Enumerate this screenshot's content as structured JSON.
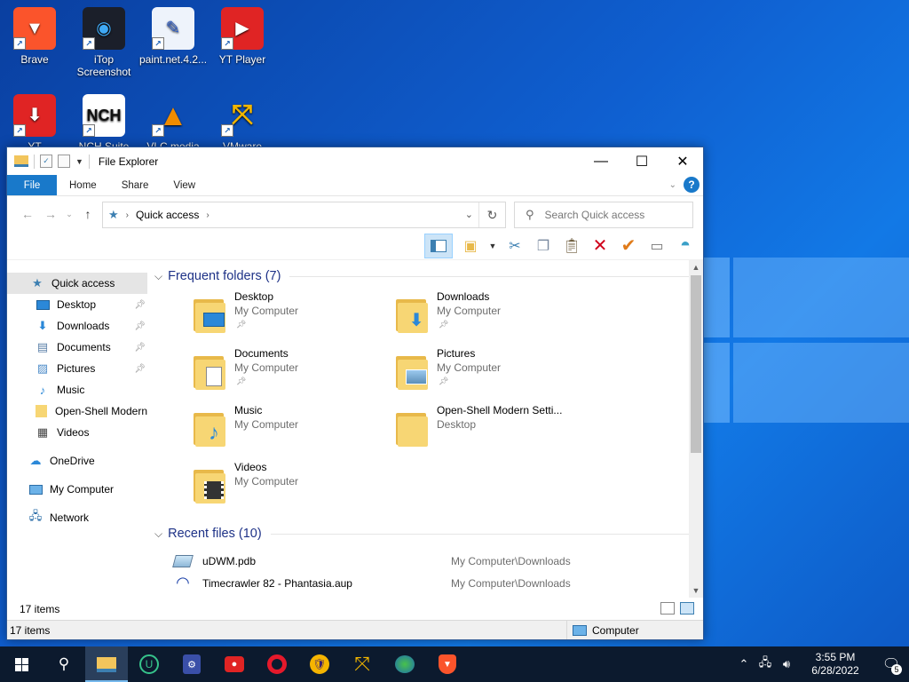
{
  "colors": {
    "accent": "#1979ca",
    "section_header": "#1e3287",
    "taskbar": "#0c1a2e"
  },
  "desktop": {
    "icons": [
      {
        "label": "Brave",
        "icon": "brave-lion-icon"
      },
      {
        "label": "iTop Screenshot",
        "icon": "camera-icon"
      },
      {
        "label": "paint.net.4.2...",
        "icon": "paint-icon"
      },
      {
        "label": "YT Player",
        "icon": "tv-play-icon"
      },
      {
        "label": "YT",
        "icon": "tv-download-icon"
      },
      {
        "label": "NCH Suite",
        "icon": "nch-icon"
      },
      {
        "label": "VLC media",
        "icon": "vlc-cone-icon"
      },
      {
        "label": "VMware",
        "icon": "vmware-icon"
      }
    ]
  },
  "window": {
    "title": "File Explorer",
    "tabs": [
      "File",
      "Home",
      "Share",
      "View"
    ],
    "address": {
      "crumb": "Quick access"
    },
    "search_placeholder": "Search Quick access",
    "nav": {
      "quick_access": "Quick access",
      "pinned": [
        "Desktop",
        "Downloads",
        "Documents",
        "Pictures"
      ],
      "others": [
        "Music",
        "Open-Shell Modern",
        "Videos"
      ],
      "onedrive": "OneDrive",
      "my_computer": "My Computer",
      "network": "Network"
    },
    "frequent": {
      "header": "Frequent folders (7)",
      "items": [
        {
          "name": "Desktop",
          "loc": "My Computer",
          "pinned": true
        },
        {
          "name": "Downloads",
          "loc": "My Computer",
          "pinned": true
        },
        {
          "name": "Documents",
          "loc": "My Computer",
          "pinned": true
        },
        {
          "name": "Pictures",
          "loc": "My Computer",
          "pinned": true
        },
        {
          "name": "Music",
          "loc": "My Computer",
          "pinned": false
        },
        {
          "name": "Open-Shell Modern Setti...",
          "loc": "Desktop",
          "pinned": false
        },
        {
          "name": "Videos",
          "loc": "My Computer",
          "pinned": false
        }
      ]
    },
    "recent": {
      "header": "Recent files (10)",
      "items": [
        {
          "name": "uDWM.pdb",
          "path": "My Computer\\Downloads"
        },
        {
          "name": "Timecrawler 82 - Phantasia.aup",
          "path": "My Computer\\Downloads"
        }
      ]
    },
    "status_items": "17 items",
    "bottom_items": "17 items",
    "bottom_location": "Computer"
  },
  "taskbar": {
    "time": "3:55 PM",
    "date": "6/28/2022",
    "notification_count": "5"
  }
}
